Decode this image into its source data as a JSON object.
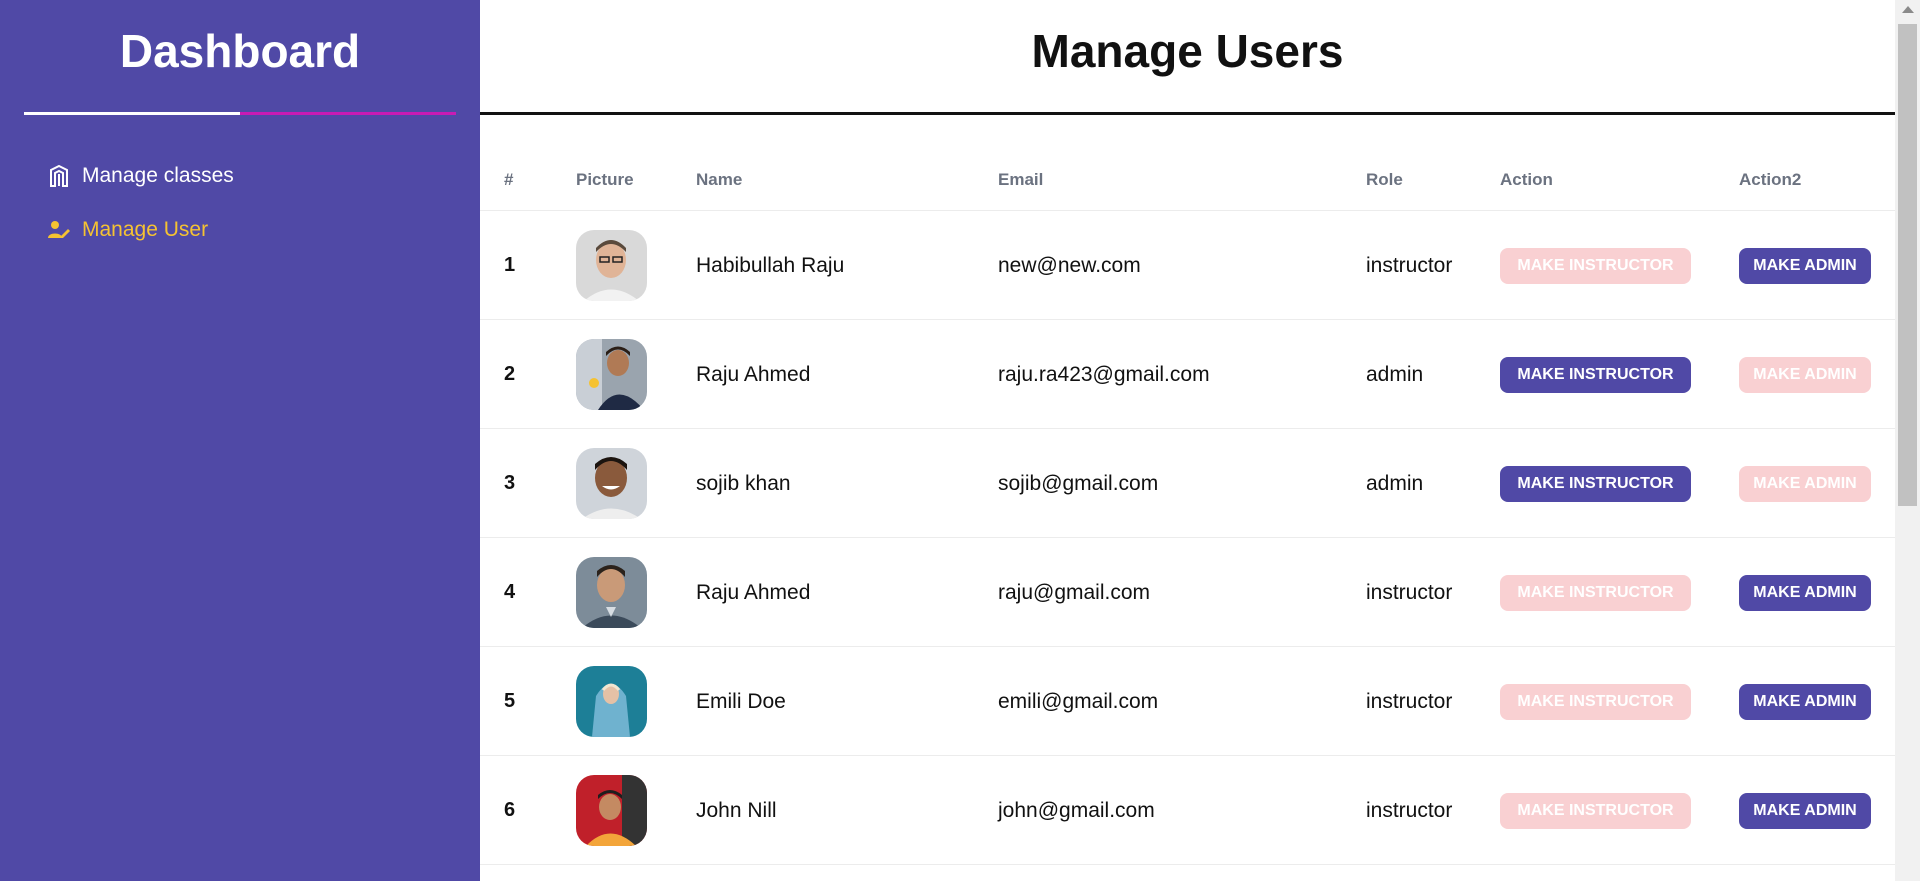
{
  "sidebar": {
    "title": "Dashboard",
    "items": [
      {
        "label": "Manage classes",
        "icon": "building-icon",
        "active": false
      },
      {
        "label": "Manage User",
        "icon": "user-edit-icon",
        "active": true
      }
    ]
  },
  "main": {
    "title": "Manage Users",
    "table": {
      "headers": [
        "#",
        "Picture",
        "Name",
        "Email",
        "Role",
        "Action",
        "Action2"
      ],
      "rows": [
        {
          "num": "1",
          "name": "Habibullah Raju",
          "email": "new@new.com",
          "role": "instructor",
          "action1": "MAKE INSTRUCTOR",
          "action2": "MAKE ADMIN"
        },
        {
          "num": "2",
          "name": "Raju Ahmed",
          "email": "raju.ra423@gmail.com",
          "role": "admin",
          "action1": "MAKE INSTRUCTOR",
          "action2": "MAKE ADMIN"
        },
        {
          "num": "3",
          "name": "sojib khan",
          "email": "sojib@gmail.com",
          "role": "admin",
          "action1": "MAKE INSTRUCTOR",
          "action2": "MAKE ADMIN"
        },
        {
          "num": "4",
          "name": "Raju Ahmed",
          "email": "raju@gmail.com",
          "role": "instructor",
          "action1": "MAKE INSTRUCTOR",
          "action2": "MAKE ADMIN"
        },
        {
          "num": "5",
          "name": "Emili Doe",
          "email": "emili@gmail.com",
          "role": "instructor",
          "action1": "MAKE INSTRUCTOR",
          "action2": "MAKE ADMIN"
        },
        {
          "num": "6",
          "name": "John Nill",
          "email": "john@gmail.com",
          "role": "instructor",
          "action1": "MAKE INSTRUCTOR",
          "action2": "MAKE ADMIN"
        }
      ]
    }
  },
  "colors": {
    "sidebar_bg": "#5049a6",
    "active_nav": "#f5c232",
    "accent_line": "#c81bb4",
    "button_active": "#5049a6",
    "button_disabled": "#f9d0d2"
  }
}
